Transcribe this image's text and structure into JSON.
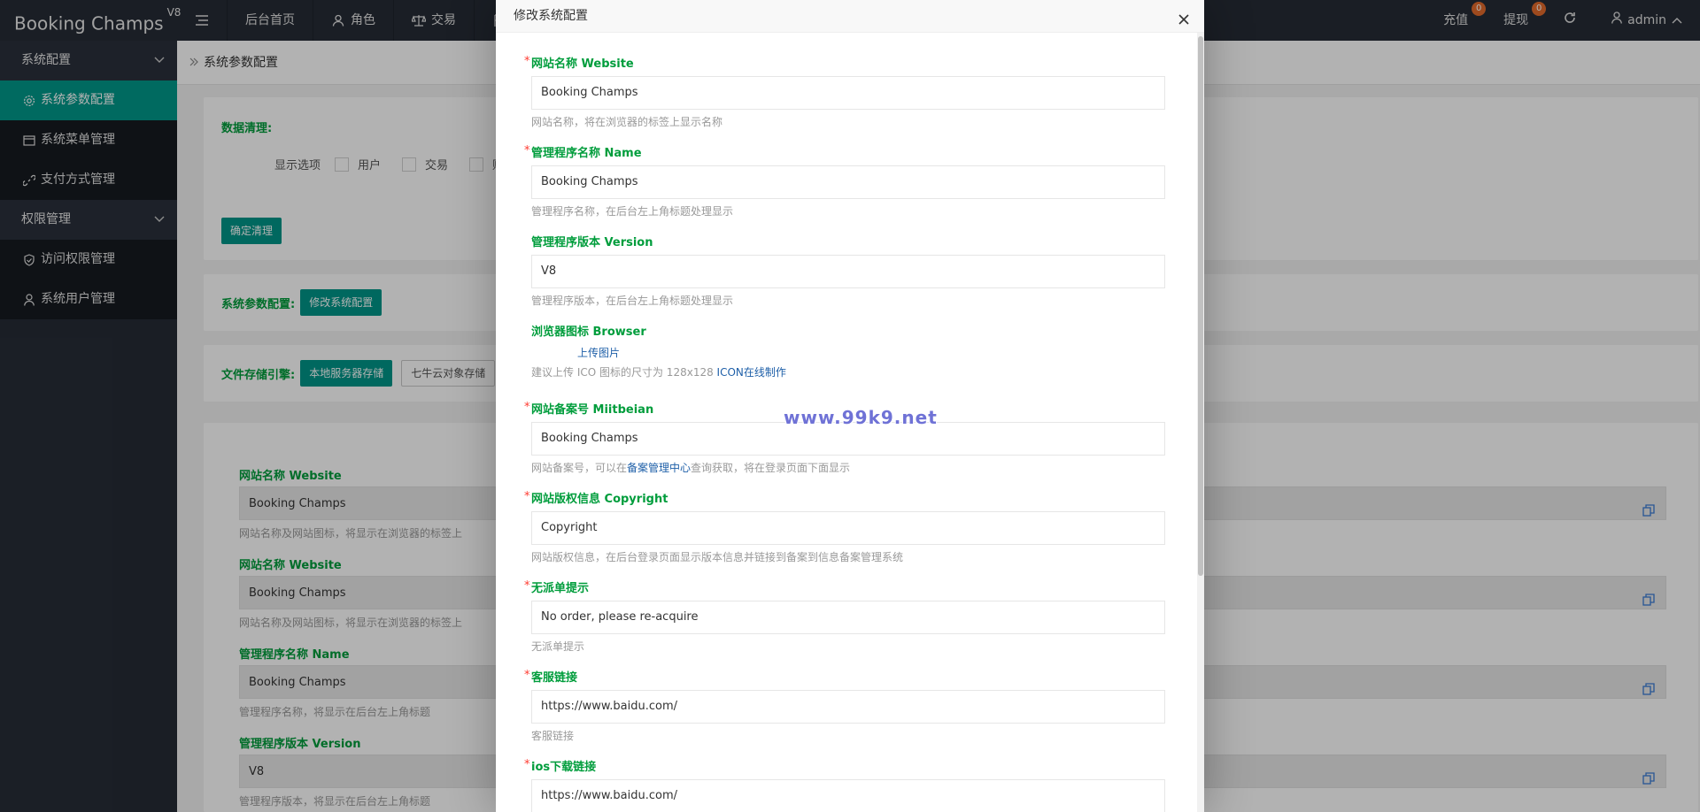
{
  "app": {
    "title": "Booking Champs",
    "version": "V8"
  },
  "topnav": {
    "items": [
      {
        "label": "后台首页",
        "icon": "menu-icon"
      },
      {
        "label": "角色",
        "icon": "user-icon"
      },
      {
        "label": "交易",
        "icon": "scale-icon"
      }
    ],
    "right": [
      {
        "label": "充值",
        "badge": "0"
      },
      {
        "label": "提现",
        "badge": "0"
      }
    ],
    "user": "admin"
  },
  "sidebar": {
    "groups": [
      {
        "label": "系统配置",
        "items": [
          "系统参数配置",
          "系统菜单管理",
          "支付方式管理"
        ]
      },
      {
        "label": "权限管理",
        "items": [
          "访问权限管理",
          "系统用户管理"
        ]
      }
    ]
  },
  "breadcrumb": "系统参数配置",
  "cleanup": {
    "title": "数据清理:",
    "options_label": "显示选项",
    "options": [
      "用户",
      "交易",
      "财务"
    ],
    "confirm": "确定清理"
  },
  "sysparam": {
    "label": "系统参数配置:",
    "button": "修改系统配置"
  },
  "storage": {
    "label": "文件存储引擎:",
    "buttons": [
      "本地服务器存储",
      "七牛云对象存储"
    ]
  },
  "bg_fields": [
    {
      "label": "网站名称 Website",
      "value": "Booking Champs",
      "help": "网站名称及网站图标，将显示在浏览器的标签上"
    },
    {
      "label": "网站名称 Website",
      "value": "Booking Champs",
      "help": "网站名称及网站图标，将显示在浏览器的标签上"
    },
    {
      "label": "管理程序名称 Name",
      "value": "Booking Champs",
      "help": "管理程序名称，将显示在后台左上角标题"
    },
    {
      "label": "管理程序版本 Version",
      "value": "V8",
      "help": "管理程序版本，将显示在后台左上角标题"
    }
  ],
  "modal": {
    "title": "修改系统配置",
    "fields": {
      "website": {
        "label": "网站名称 Website",
        "value": "Booking Champs",
        "help": "网站名称，将在浏览器的标签上显示名称"
      },
      "name": {
        "label": "管理程序名称 Name",
        "value": "Booking Champs",
        "help": "管理程序名称，在后台左上角标题处理显示"
      },
      "version": {
        "label": "管理程序版本 Version",
        "value": "V8",
        "help": "管理程序版本，在后台左上角标题处理显示"
      },
      "browser": {
        "label": "浏览器图标 Browser",
        "upload": "上传图片",
        "help_prefix": "建议上传 ICO 图标的尺寸为 128x128 ",
        "help_link": "ICON在线制作"
      },
      "miitbeian": {
        "label": "网站备案号 Miitbeian",
        "value": "Booking Champs",
        "help_prefix": "网站备案号，可以在",
        "help_link": "备案管理中心",
        "help_suffix": "查询获取，将在登录页面下面显示"
      },
      "copyright": {
        "label": "网站版权信息 Copyright",
        "value": "Copyright",
        "help": "网站版权信息，在后台登录页面显示版本信息并链接到备案到信息备案管理系统"
      },
      "noorder": {
        "label": "无派单提示",
        "value": "No order, please re-acquire",
        "help": "无派单提示"
      },
      "service": {
        "label": "客服链接",
        "value": "https://www.baidu.com/",
        "help": "客服链接"
      },
      "ios": {
        "label": "ios下载链接",
        "value": "https://www.baidu.com/"
      }
    }
  },
  "watermark": "www.99k9.net",
  "colors": {
    "accent": "#009688",
    "label_green": "#009d3c",
    "sidebar": "#262c36",
    "badge": "#e26a2c"
  }
}
